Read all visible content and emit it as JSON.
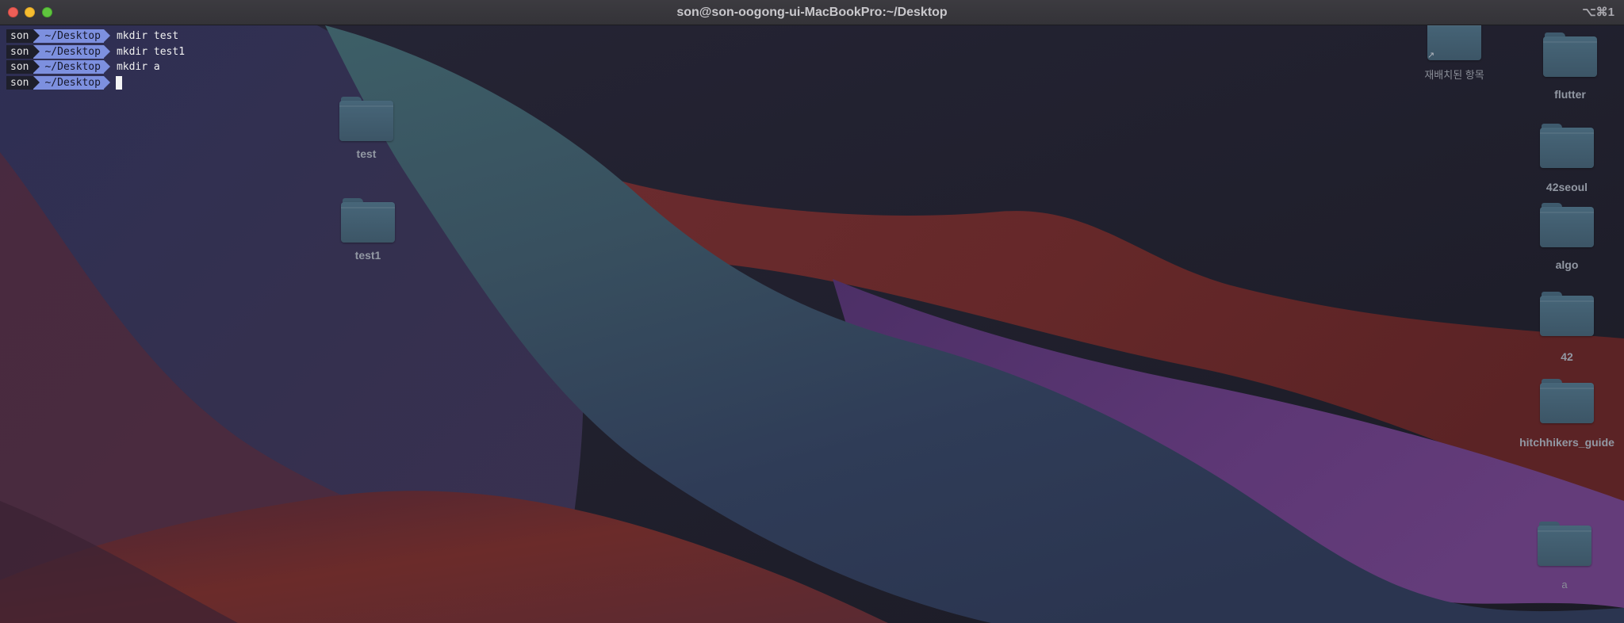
{
  "window": {
    "title": "son@son-oogong-ui-MacBookPro:~/Desktop",
    "shortcut": "⌥⌘1"
  },
  "terminal": {
    "lines": [
      {
        "user": "son",
        "path": "~/Desktop",
        "command": "mkdir test"
      },
      {
        "user": "son",
        "path": "~/Desktop",
        "command": "mkdir test1"
      },
      {
        "user": "son",
        "path": "~/Desktop",
        "command": "mkdir a"
      },
      {
        "user": "son",
        "path": "~/Desktop",
        "command": ""
      }
    ]
  },
  "desktop": {
    "icons": [
      {
        "label": "test",
        "icon": "folder-icon"
      },
      {
        "label": "test1",
        "icon": "folder-icon"
      },
      {
        "label": "재배치된 항목",
        "icon": "folder-icon"
      },
      {
        "label": "flutter",
        "icon": "folder-icon"
      },
      {
        "label": "42seoul",
        "icon": "folder-icon"
      },
      {
        "label": "algo",
        "icon": "folder-icon"
      },
      {
        "label": "42",
        "icon": "folder-icon"
      },
      {
        "label": "hitchhikers_guide",
        "icon": "folder-icon"
      },
      {
        "label": "a",
        "icon": "folder-icon"
      }
    ]
  },
  "colors": {
    "prompt_user_bg": "#1e1f2b",
    "prompt_path_bg": "#7d90df",
    "folder": "#476679",
    "close": "#ee5f57",
    "minimize": "#f6bd30",
    "maximize": "#5fc53e"
  }
}
